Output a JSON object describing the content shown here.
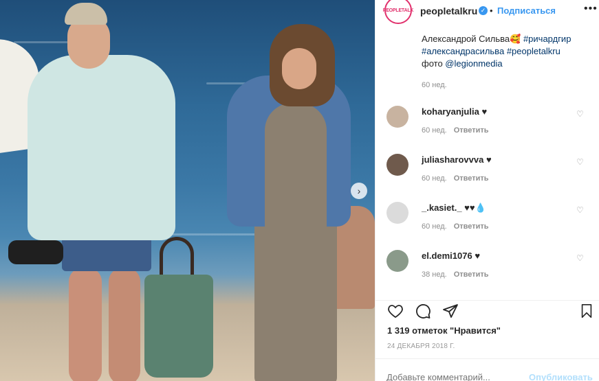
{
  "post": {
    "account": "peopletalkru",
    "avatar_text": "PEOPLETALK",
    "follow_label": "Подписаться",
    "more_label": "•••",
    "caption_lines": [
      "Александрой Сильва🥰 ",
      "#ричардгир",
      "#александрасильва",
      "#peopletalkru",
      "фото ",
      "@legionmedia"
    ],
    "caption_time": "60 нед."
  },
  "comments": [
    {
      "user": "koharyanjulia",
      "text": "♥",
      "time": "60 нед.",
      "reply": "Ответить",
      "avatar_color": "#c8b3a0"
    },
    {
      "user": "juliasharovvva",
      "text": "♥",
      "time": "60 нед.",
      "reply": "Ответить",
      "avatar_color": "#6f5a4c"
    },
    {
      "user": "_.kasiet._",
      "text": "♥♥💧",
      "time": "60 нед.",
      "reply": "Ответить",
      "avatar_color": "#dbdbdb"
    },
    {
      "user": "el.demi1076",
      "text": "♥",
      "time": "38 нед.",
      "reply": "Ответить",
      "avatar_color": "#8a9a8a"
    }
  ],
  "likes_text": "1 319 отметок \"Нравится\"",
  "date_text": "24 ДЕКАБРЯ 2018 Г.",
  "add_comment_placeholder": "Добавьте комментарий...",
  "publish_label": "Опубликовать",
  "icons": {
    "like": "heart-icon",
    "comment": "comment-icon",
    "share": "share-icon",
    "save": "bookmark-icon"
  }
}
